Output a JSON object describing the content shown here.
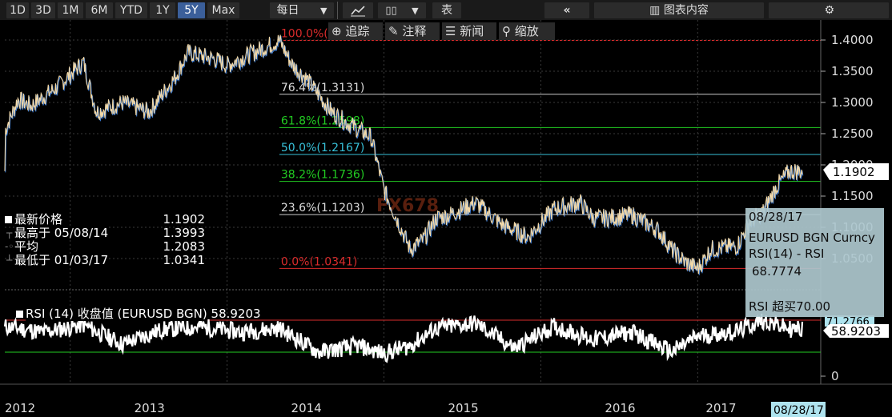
{
  "toolbar": {
    "periods": [
      "1D",
      "3D",
      "1M",
      "6M",
      "YTD",
      "1Y",
      "5Y",
      "Max"
    ],
    "active_period": "5Y",
    "frequency": "每日",
    "table_label": "表",
    "panel_label": "图表内容"
  },
  "controls": {
    "track": "追踪",
    "annotate": "注释",
    "news": "新闻",
    "zoom": "缩放"
  },
  "legend": {
    "last_label": "最新价格",
    "last_value": "1.1902",
    "high_label": "最高于 05/08/14",
    "high_value": "1.3993",
    "avg_label": "平均",
    "avg_value": "1.2083",
    "low_label": "最低于 01/03/17",
    "low_value": "1.0341"
  },
  "info_box": {
    "date": "08/28/17",
    "series": "EURUSD BGN Curncy",
    "indicator": "RSI(14) - RSI",
    "value": "68.7774",
    "overbought": "RSI 超买70.00"
  },
  "rsi_header": {
    "label": "RSI (14) 收盘值 (EURUSD BGN)",
    "value": "58.9203"
  },
  "current_price_tag": "1.1902",
  "rsi_tags": {
    "upper": "71.2766",
    "current": "58.9203"
  },
  "date_tag": "08/28/17",
  "watermark": "FX678",
  "colors": {
    "price_line": "#f3d9a8",
    "fib_red": "#d92b2b",
    "fib_white": "#cccccc",
    "fib_green": "#22cc22",
    "fib_cyan": "#37c0d8",
    "rsi_line": "#ffffff",
    "rsi_upper": "#d92b2b",
    "rsi_lower": "#22cc22",
    "grid": "#3a3a3a"
  },
  "chart_data": [
    {
      "type": "line",
      "title": "EURUSD BGN Curncy",
      "x_labels": [
        "2012",
        "2013",
        "2014",
        "2015",
        "2016",
        "2017"
      ],
      "y_ticks": [
        "1.4000",
        "1.3500",
        "1.3000",
        "1.2500",
        "1.2000",
        "1.1500",
        "1.1000",
        "1.0500"
      ],
      "ylim": [
        1.02,
        1.42
      ],
      "series": [
        {
          "name": "EURUSD BGN Curncy",
          "x": [
            "2012-08",
            "2012-09",
            "2012-10",
            "2012-12",
            "2013-02",
            "2013-03",
            "2013-05",
            "2013-07",
            "2013-09",
            "2013-10",
            "2013-12",
            "2014-01",
            "2014-03",
            "2014-05",
            "2014-06",
            "2014-07",
            "2014-09",
            "2014-10",
            "2014-12",
            "2015-01",
            "2015-03",
            "2015-04",
            "2015-05",
            "2015-06",
            "2015-08",
            "2015-10",
            "2015-12",
            "2016-02",
            "2016-04",
            "2016-05",
            "2016-06",
            "2016-08",
            "2016-10",
            "2016-11",
            "2016-12",
            "2017-01",
            "2017-02",
            "2017-04",
            "2017-05",
            "2017-06",
            "2017-07",
            "2017-08"
          ],
          "values": [
            1.255,
            1.305,
            1.295,
            1.325,
            1.365,
            1.285,
            1.3,
            1.285,
            1.34,
            1.38,
            1.37,
            1.36,
            1.38,
            1.3993,
            1.36,
            1.34,
            1.285,
            1.27,
            1.245,
            1.16,
            1.065,
            1.08,
            1.115,
            1.12,
            1.14,
            1.105,
            1.085,
            1.13,
            1.14,
            1.115,
            1.115,
            1.12,
            1.095,
            1.065,
            1.045,
            1.0341,
            1.065,
            1.07,
            1.11,
            1.125,
            1.165,
            1.1902
          ]
        }
      ],
      "fibonacci": [
        {
          "label": "100.0%(1.3993)",
          "value": 1.3993
        },
        {
          "label": "76.4%(1.3131)",
          "value": 1.3131
        },
        {
          "label": "61.8%(1.2598)",
          "value": 1.2598
        },
        {
          "label": "50.0%(1.2167)",
          "value": 1.2167
        },
        {
          "label": "38.2%(1.1736)",
          "value": 1.1736
        },
        {
          "label": "23.6%(1.1203)",
          "value": 1.1203
        },
        {
          "label": "0.0%(1.0341)",
          "value": 1.0341
        }
      ]
    },
    {
      "type": "line",
      "title": "RSI (14) 收盘值 (EURUSD BGN)",
      "y_ticks": [
        "0"
      ],
      "ylim": [
        0,
        100
      ],
      "series": [
        {
          "name": "RSI (14)",
          "x": [
            "2012-08",
            "2012-11",
            "2013-02",
            "2013-05",
            "2013-08",
            "2013-11",
            "2014-02",
            "2014-05",
            "2014-08",
            "2014-11",
            "2015-01",
            "2015-03",
            "2015-05",
            "2015-08",
            "2015-11",
            "2016-02",
            "2016-05",
            "2016-08",
            "2016-11",
            "2017-01",
            "2017-04",
            "2017-06",
            "2017-08"
          ],
          "values": [
            62,
            55,
            64,
            40,
            58,
            62,
            55,
            60,
            30,
            38,
            28,
            38,
            60,
            66,
            35,
            62,
            46,
            55,
            30,
            50,
            56,
            70,
            58.92
          ]
        }
      ],
      "levels": [
        70,
        30
      ]
    }
  ]
}
